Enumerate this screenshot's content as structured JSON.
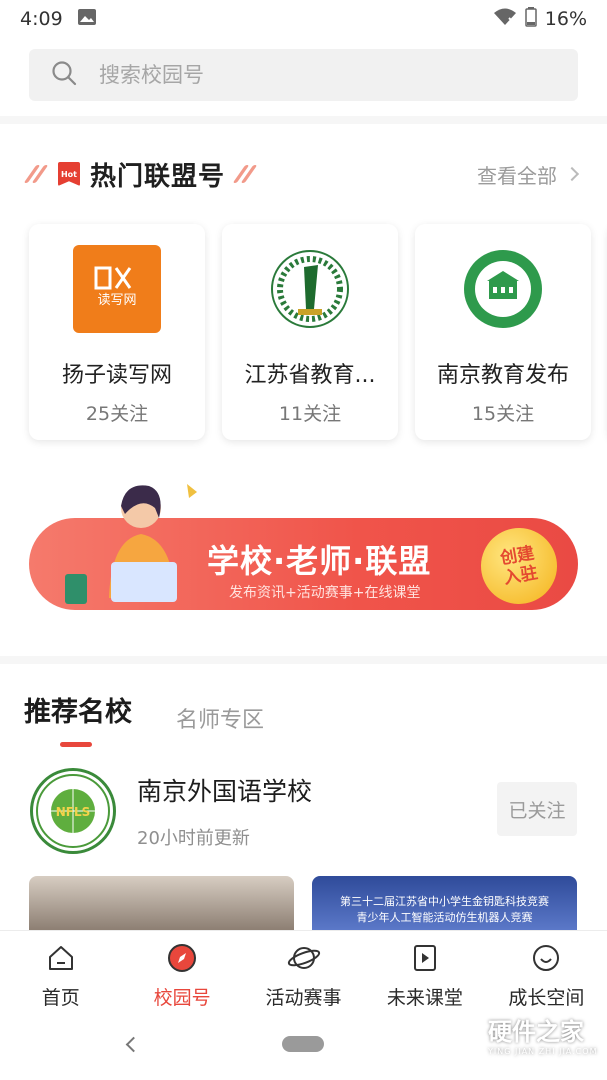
{
  "status_bar": {
    "time": "4:09",
    "battery": "16%"
  },
  "search": {
    "placeholder": "搜索校园号"
  },
  "hot_section": {
    "hot_badge": "Hot",
    "title": "热门联盟号",
    "view_all": "查看全部",
    "cards": [
      {
        "name": "扬子读写网",
        "followers": "25关注"
      },
      {
        "name": "江苏省教育...",
        "followers": "11关注"
      },
      {
        "name": "南京教育发布",
        "followers": "15关注"
      }
    ]
  },
  "banner": {
    "title": "学校·老师·联盟",
    "subtitle": "发布资讯+活动赛事+在线课堂",
    "badge_line1": "创建",
    "badge_line2": "入驻"
  },
  "tabs": {
    "active": "推荐名校",
    "inactive": "名师专区"
  },
  "school": {
    "name": "南京外国语学校",
    "updated": "20小时前更新",
    "follow_label": "已关注",
    "logo_text": "NFLS"
  },
  "photos": {
    "caption_line1": "第三十二届江苏省中小学生金钥匙科技竞赛",
    "caption_line2": "青少年人工智能活动仿生机器人竞赛"
  },
  "bottom_nav": [
    {
      "label": "首页",
      "icon": "home-icon"
    },
    {
      "label": "校园号",
      "icon": "compass-icon"
    },
    {
      "label": "活动赛事",
      "icon": "planet-icon"
    },
    {
      "label": "未来课堂",
      "icon": "play-book-icon"
    },
    {
      "label": "成长空间",
      "icon": "smile-icon"
    }
  ],
  "watermark": {
    "title": "硬件之家",
    "subtitle": "YING JIAN ZHI JIA.COM"
  },
  "colors": {
    "accent": "#e8473c",
    "banner_start": "#f57a6c",
    "banner_end": "#ea4a44"
  }
}
